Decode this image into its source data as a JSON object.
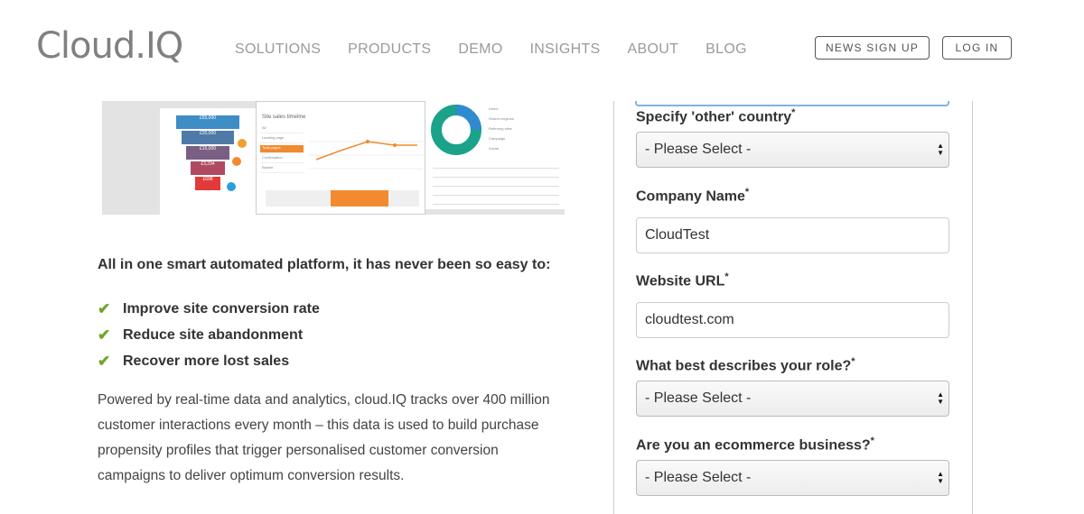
{
  "header": {
    "logo": "Cloud.IQ",
    "nav": [
      "SOLUTIONS",
      "PRODUCTS",
      "DEMO",
      "INSIGHTS",
      "ABOUT",
      "BLOG"
    ],
    "news_signup": "NEWS SIGN UP",
    "login": "LOG IN"
  },
  "dashboard": {
    "funnel": [
      "£55,000",
      "£20,000",
      "£15,000",
      "£3,294",
      "£698"
    ],
    "line_title": "Site sales timeline",
    "menu": [
      "All",
      "Landing page",
      "Total pages",
      "Confirmation",
      "Basket"
    ],
    "legend": [
      "Direct",
      "Search engines",
      "Referring sites",
      "Campaign",
      "Social"
    ],
    "colors": {
      "funnel_top": "#3d8dc6",
      "funnel_mid": "#5f6a8c",
      "funnel_low": "#9e4e6a",
      "funnel_bottom": "#e23a3a",
      "accent": "#f28a30",
      "donut_teal": "#1aa38a",
      "donut_blue": "#2e8bcf"
    }
  },
  "left": {
    "intro": "All in one smart automated platform, it has never been so easy to:",
    "bullets": [
      "Improve site conversion rate",
      "Reduce site abandonment",
      "Recover more lost sales"
    ],
    "description": "Powered by real-time data and analytics, cloud.IQ tracks over 400 million customer interactions every month – this data is used to build purchase propensity profiles that trigger personalised customer conversion campaigns to deliver optimum conversion results."
  },
  "form": {
    "other_country_label": "Specify 'other' country",
    "other_country_value": "- Please Select -",
    "company_label": "Company Name",
    "company_value": "CloudTest",
    "website_label": "Website URL",
    "website_value": "cloudtest.com",
    "role_label": "What best describes your role?",
    "role_value": "- Please Select -",
    "ecommerce_label": "Are you an ecommerce business?",
    "ecommerce_value": "- Please Select -",
    "required_mark": "*"
  }
}
